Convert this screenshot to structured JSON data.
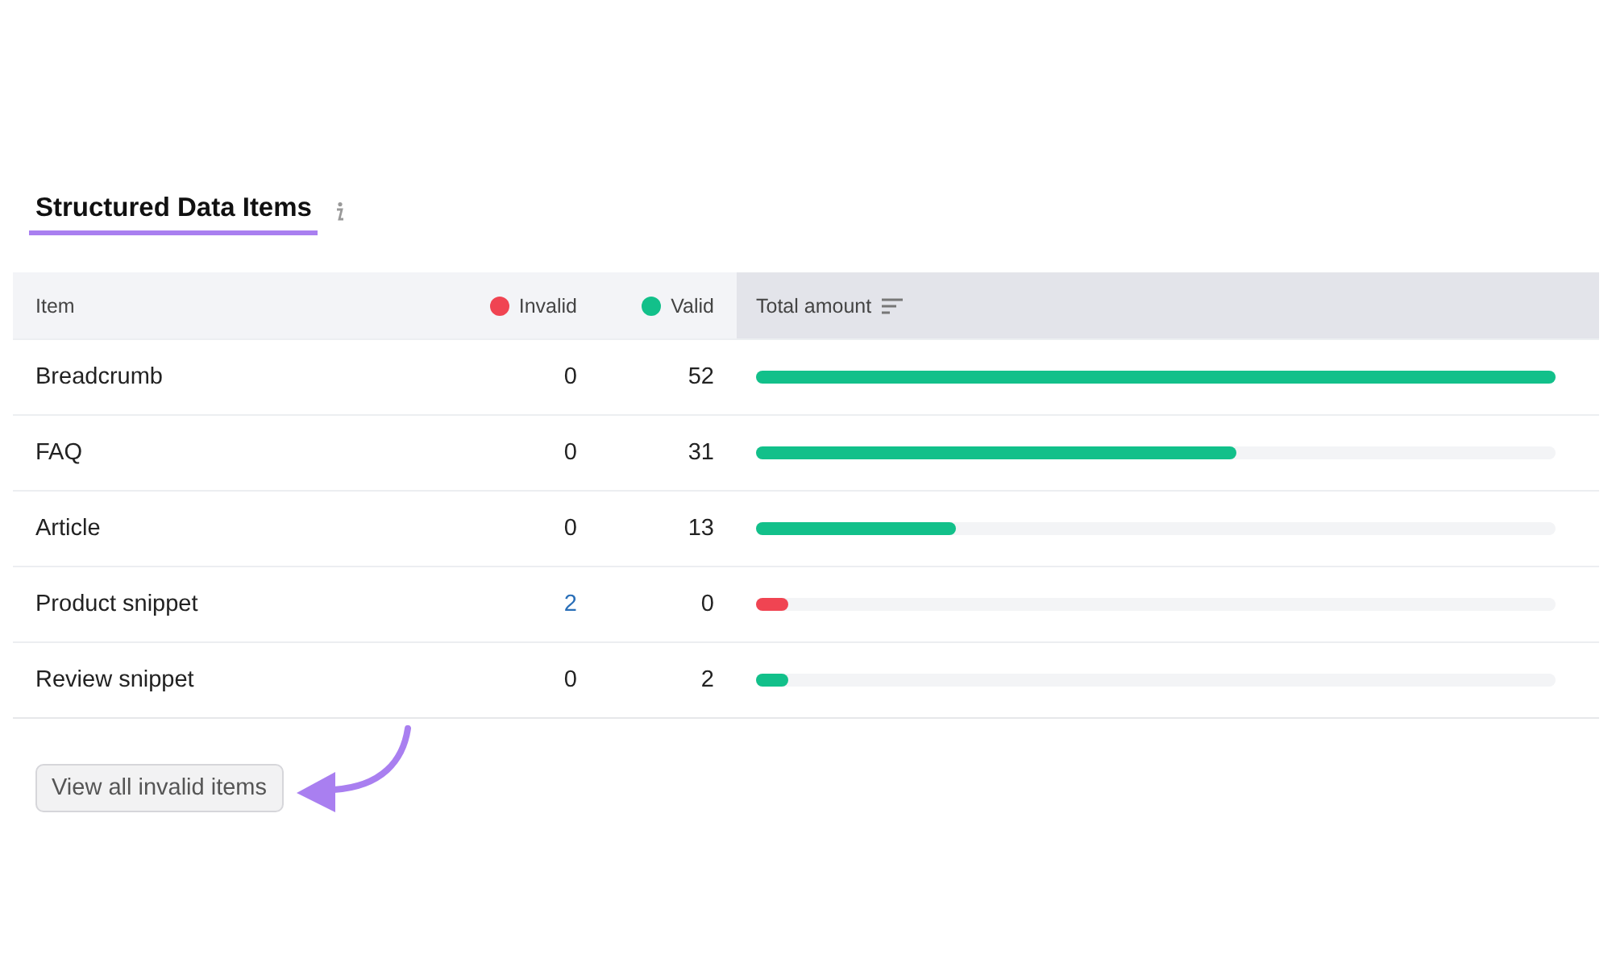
{
  "title": "Structured Data Items",
  "columns": [
    {
      "label": "Item",
      "kind": "item",
      "sorted": false
    },
    {
      "label": "Invalid",
      "kind": "invalid",
      "color": "#f04452",
      "sorted": false
    },
    {
      "label": "Valid",
      "kind": "valid",
      "color": "#12c08a",
      "sorted": false
    },
    {
      "label": "Total amount",
      "kind": "total",
      "sorted": true
    }
  ],
  "rows": [
    {
      "item": "Breadcrumb",
      "invalid": "0",
      "valid": "52",
      "invalid_linked": false,
      "level": 1.0,
      "color": "#12c08a"
    },
    {
      "item": "FAQ",
      "invalid": "0",
      "valid": "31",
      "invalid_linked": false,
      "level": 0.6,
      "color": "#12c08a"
    },
    {
      "item": "Article",
      "invalid": "0",
      "valid": "13",
      "invalid_linked": false,
      "level": 0.25,
      "color": "#12c08a"
    },
    {
      "item": "Product snippet",
      "invalid": "2",
      "valid": "0",
      "invalid_linked": true,
      "level": 0.04,
      "color": "#f04452"
    },
    {
      "item": "Review snippet",
      "invalid": "0",
      "valid": "2",
      "invalid_linked": false,
      "level": 0.04,
      "color": "#12c08a"
    }
  ],
  "button": "View all invalid items"
}
